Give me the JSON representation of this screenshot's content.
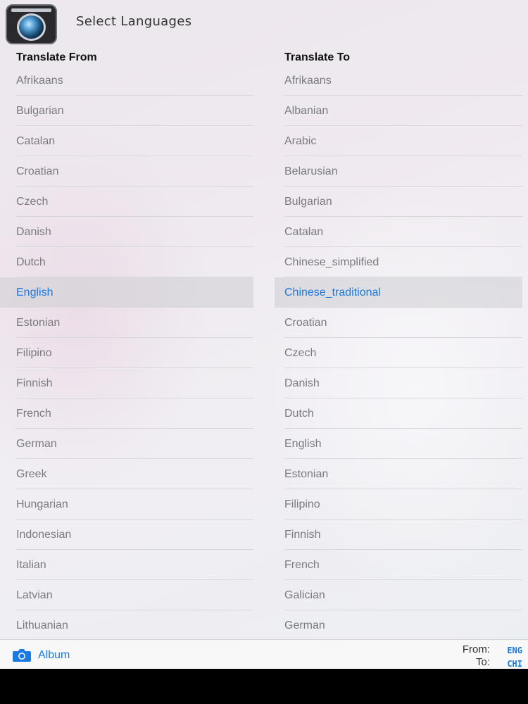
{
  "header": {
    "title": "Select Languages",
    "app_icon": "camera-lens-app-icon"
  },
  "translate_from": {
    "header": "Translate From",
    "selected": "English",
    "items": [
      "Afrikaans",
      "Bulgarian",
      "Catalan",
      "Croatian",
      "Czech",
      "Danish",
      "Dutch",
      "English",
      "Estonian",
      "Filipino",
      "Finnish",
      "French",
      "German",
      "Greek",
      "Hungarian",
      "Indonesian",
      "Italian",
      "Latvian",
      "Lithuanian"
    ]
  },
  "translate_to": {
    "header": "Translate To",
    "selected": "Chinese_traditional",
    "items": [
      "Afrikaans",
      "Albanian",
      "Arabic",
      "Belarusian",
      "Bulgarian",
      "Catalan",
      "Chinese_simplified",
      "Chinese_traditional",
      "Croatian",
      "Czech",
      "Danish",
      "Dutch",
      "English",
      "Estonian",
      "Filipino",
      "Finnish",
      "French",
      "Galician",
      "German"
    ]
  },
  "toolbar": {
    "album_label": "Album",
    "album_icon": "camera-icon",
    "from_label": "From:",
    "from_code": "ENG",
    "to_label": "To:",
    "to_code": "CHI"
  },
  "colors": {
    "accent": "#1a7ae0",
    "item_text": "#7a7a7f",
    "selected_row_bg": "#d4d4d9"
  }
}
